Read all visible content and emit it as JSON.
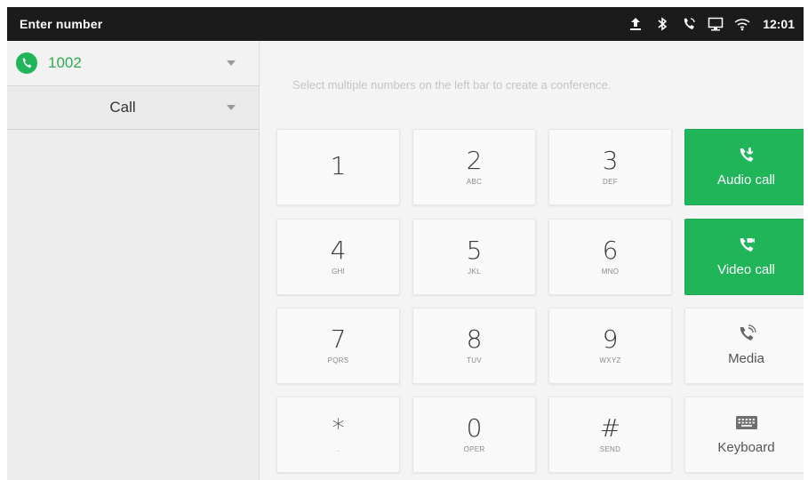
{
  "statusbar": {
    "title": "Enter number",
    "time": "12:01",
    "icons": [
      "upload-icon",
      "bluetooth-icon",
      "call-active-icon",
      "screen-cast-icon",
      "wifi-icon"
    ]
  },
  "left_panel": {
    "account_number": "1002",
    "call_mode": "Call"
  },
  "hint": "Select multiple numbers on the left bar to create a conference.",
  "keypad": [
    {
      "digit": "1",
      "sub": ""
    },
    {
      "digit": "2",
      "sub": "ABC"
    },
    {
      "digit": "3",
      "sub": "DEF"
    },
    {
      "digit": "4",
      "sub": "GHI"
    },
    {
      "digit": "5",
      "sub": "JKL"
    },
    {
      "digit": "6",
      "sub": "MNO"
    },
    {
      "digit": "7",
      "sub": "PQRS"
    },
    {
      "digit": "8",
      "sub": "TUV"
    },
    {
      "digit": "9",
      "sub": "WXYZ"
    },
    {
      "digit": "*",
      "sub": "."
    },
    {
      "digit": "0",
      "sub": "OPER"
    },
    {
      "digit": "#",
      "sub": "SEND"
    }
  ],
  "actions": {
    "audio_call": "Audio call",
    "video_call": "Video call",
    "media": "Media",
    "keyboard": "Keyboard"
  },
  "colors": {
    "accent_green": "#21b55a",
    "statusbar_bg": "#1b1b1b"
  }
}
